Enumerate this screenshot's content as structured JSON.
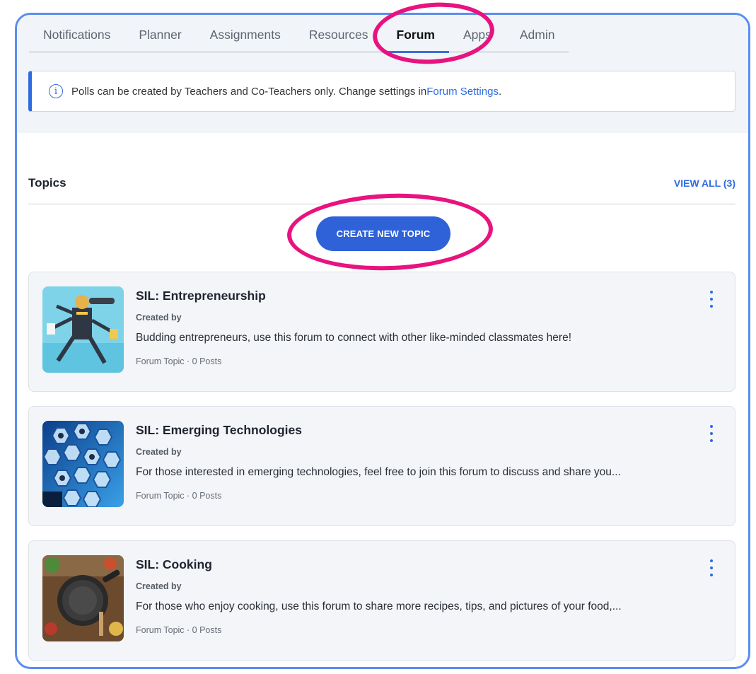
{
  "tabs": [
    {
      "label": "Notifications",
      "active": false
    },
    {
      "label": "Planner",
      "active": false
    },
    {
      "label": "Assignments",
      "active": false
    },
    {
      "label": "Resources",
      "active": false
    },
    {
      "label": "Forum",
      "active": true
    },
    {
      "label": "Apps",
      "active": false
    },
    {
      "label": "Admin",
      "active": false
    }
  ],
  "alert": {
    "icon": "info-icon",
    "text": "Polls can be created by Teachers and Co-Teachers only. Change settings in ",
    "link": "Forum Settings",
    "end": "."
  },
  "topics": {
    "title": "Topics",
    "view_all": "VIEW ALL (3)",
    "create_button": "CREATE NEW TOPIC"
  },
  "cards": [
    {
      "title": "SIL: Entrepreneurship",
      "created_by": "Created by",
      "description": "Budding entrepreneurs, use this forum to connect with other like-minded classmates here!",
      "meta": "Forum Topic · 0 Posts"
    },
    {
      "title": "SIL: Emerging Technologies",
      "created_by": "Created by",
      "description": "For those interested in emerging technologies, feel free to join this forum to discuss and share you...",
      "meta": "Forum Topic · 0 Posts"
    },
    {
      "title": "SIL: Cooking",
      "created_by": "Created by",
      "description": "For those who enjoy cooking, use this forum to share more recipes, tips, and pictures of your food,...",
      "meta": "Forum Topic · 0 Posts"
    }
  ],
  "colors": {
    "accent": "#2f62d8",
    "highlight": "#e8137f",
    "frame": "#5b8def"
  }
}
